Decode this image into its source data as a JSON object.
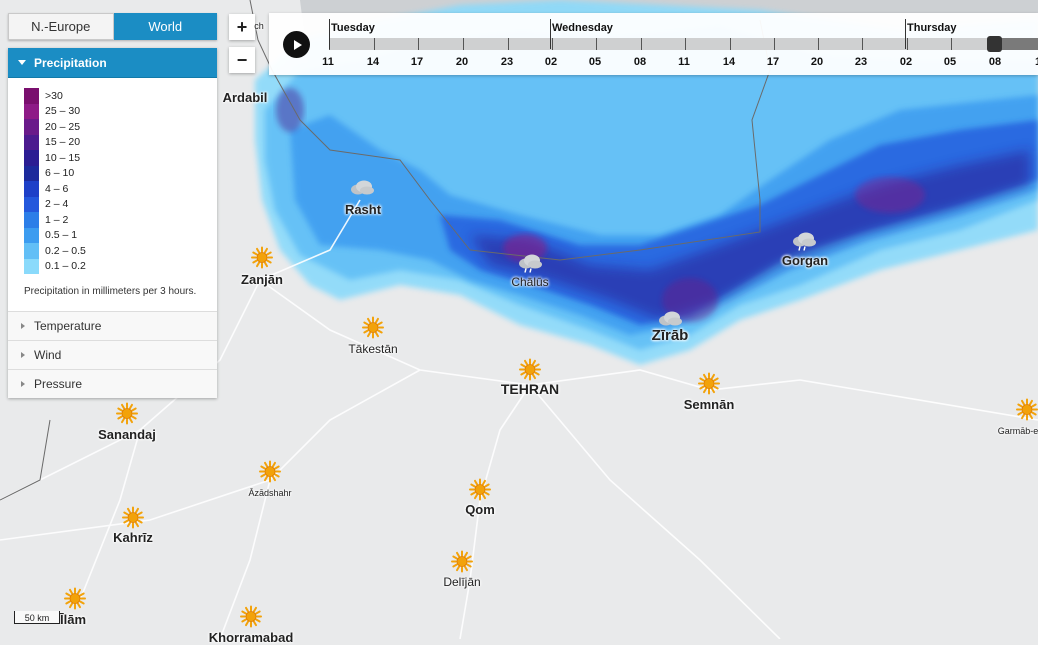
{
  "region_tabs": [
    {
      "label": "N.-Europe",
      "active": false
    },
    {
      "label": "World",
      "active": true
    }
  ],
  "layer_panel": {
    "active_layer": "Precipitation",
    "legend": [
      {
        "label": ">30",
        "color": "#7a0f6e"
      },
      {
        "label": "25 – 30",
        "color": "#8e1a87"
      },
      {
        "label": "20 – 25",
        "color": "#6a1a8a"
      },
      {
        "label": "15 – 20",
        "color": "#4c1b8f"
      },
      {
        "label": "10 – 15",
        "color": "#2b1d93"
      },
      {
        "label": "6 – 10",
        "color": "#1c2a9c"
      },
      {
        "label": "4 – 6",
        "color": "#1e40c8"
      },
      {
        "label": "2 – 4",
        "color": "#2458dc"
      },
      {
        "label": "1 – 2",
        "color": "#2c7ee8"
      },
      {
        "label": "0.5 – 1",
        "color": "#3c9cf0"
      },
      {
        "label": "0.2 – 0.5",
        "color": "#62bff6"
      },
      {
        "label": "0.1 – 0.2",
        "color": "#8adafb"
      }
    ],
    "note": "Precipitation in millimeters per 3 hours.",
    "other_layers": [
      "Temperature",
      "Wind",
      "Pressure"
    ]
  },
  "zoom": {
    "in_label": "+",
    "out_label": "−"
  },
  "timeline": {
    "days": [
      "Tuesday",
      "Wednesday",
      "Thursday"
    ],
    "hours": [
      "11",
      "14",
      "17",
      "20",
      "23",
      "02",
      "05",
      "08",
      "11",
      "14",
      "17",
      "20",
      "23",
      "02",
      "05",
      "08",
      "1"
    ],
    "selected_hour": "08"
  },
  "map": {
    "cities": [
      {
        "name": "Ardabil",
        "style": "normal"
      },
      {
        "name": "Rasht",
        "style": "normal",
        "weather": "cloud-icon"
      },
      {
        "name": "Zanjān",
        "style": "normal",
        "weather": "sun-icon"
      },
      {
        "name": "Chālūs",
        "style": "small",
        "weather": "rain-cloud-icon"
      },
      {
        "name": "Gorgan",
        "style": "normal",
        "weather": "rain-cloud-icon"
      },
      {
        "name": "Zīrāb",
        "style": "big",
        "weather": "cloud-icon"
      },
      {
        "name": "Tākestān",
        "style": "small",
        "weather": "sun-icon"
      },
      {
        "name": "TEHRAN",
        "style": "capital",
        "weather": "sun-icon"
      },
      {
        "name": "Semnān",
        "style": "normal",
        "weather": "sun-icon"
      },
      {
        "name": "Sanandaj",
        "style": "normal",
        "weather": "sun-icon"
      },
      {
        "name": "Āzādshahr",
        "style": "tiny",
        "weather": "sun-icon"
      },
      {
        "name": "Qom",
        "style": "normal",
        "weather": "sun-icon"
      },
      {
        "name": "Kahrīz",
        "style": "normal",
        "weather": "sun-icon"
      },
      {
        "name": "Delījān",
        "style": "small",
        "weather": "sun-icon"
      },
      {
        "name": "Īlām",
        "style": "normal",
        "weather": "sun-icon"
      },
      {
        "name": "Khorramabad",
        "style": "normal",
        "weather": "sun-icon"
      },
      {
        "name": "Garmāb-e",
        "style": "tiny",
        "weather": "sun-icon"
      }
    ],
    "partial_label": "ch",
    "scale_label": "50 km",
    "colors": {
      "land": "#e9eaeb",
      "sea": "#cdd0d3",
      "sun": "#f2a20a"
    }
  }
}
